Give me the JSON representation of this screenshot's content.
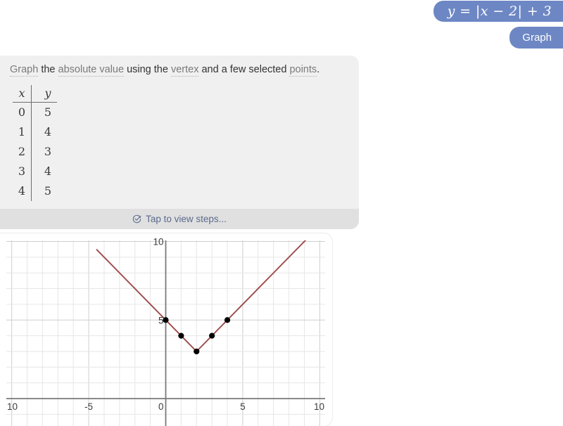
{
  "header": {
    "equation": "y = |x − 2| + 3",
    "graph_button_label": "Graph",
    "pill_color": "#6d87c4"
  },
  "answer_card": {
    "instruction": {
      "segments": [
        {
          "text": "Graph",
          "style": "term"
        },
        {
          "text": " the ",
          "style": "plain"
        },
        {
          "text": "absolute value",
          "style": "term"
        },
        {
          "text": " using the ",
          "style": "plain"
        },
        {
          "text": "vertex",
          "style": "term"
        },
        {
          "text": " and a few selected ",
          "style": "plain"
        },
        {
          "text": "points",
          "style": "term"
        },
        {
          "text": ".",
          "style": "plain"
        }
      ]
    },
    "table": {
      "headers": [
        "x",
        "y"
      ],
      "rows": [
        [
          "0",
          "5"
        ],
        [
          "1",
          "4"
        ],
        [
          "2",
          "3"
        ],
        [
          "3",
          "4"
        ],
        [
          "4",
          "5"
        ]
      ]
    },
    "steps_label": "Tap to view steps...",
    "steps_icon": "check-circle-icon"
  },
  "chart_data": {
    "type": "line",
    "title": "",
    "xlabel": "",
    "ylabel": "",
    "xlim": [
      -10.35,
      10.35
    ],
    "ylim": [
      -0.3,
      10.1
    ],
    "grid": true,
    "minor_grid_step": 1,
    "major_grid_step": 5,
    "x_tick_labels": [
      "10",
      "-5",
      "0",
      "5",
      "10"
    ],
    "x_tick_values": [
      -10,
      -5,
      0,
      5,
      10
    ],
    "y_tick_labels": [
      "10",
      "5",
      "0"
    ],
    "y_tick_values": [
      10,
      5,
      0
    ],
    "series": [
      {
        "name": "y = |x - 2| + 3",
        "type": "line",
        "color": "#9e4b4b",
        "x": [
          -4.5,
          2,
          9.2
        ],
        "y": [
          9.5,
          3,
          10.2
        ]
      }
    ],
    "points": [
      {
        "x": 0,
        "y": 5
      },
      {
        "x": 1,
        "y": 4
      },
      {
        "x": 2,
        "y": 3
      },
      {
        "x": 3,
        "y": 4
      },
      {
        "x": 4,
        "y": 5
      }
    ],
    "point_color": "#000000",
    "axis_color": "#7a7a7a",
    "grid_color": "#e6e6e6",
    "major_grid_color": "#cfcfcf"
  }
}
